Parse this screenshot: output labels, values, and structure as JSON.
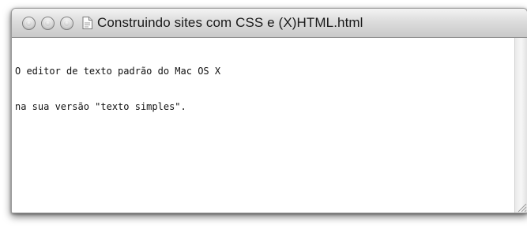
{
  "window": {
    "title": "Construindo sites com  CSS e (X)HTML.html",
    "controls": [
      "close",
      "minimize",
      "zoom"
    ],
    "document_icon": "document-icon"
  },
  "editor": {
    "lines": [
      "O editor de texto padrão do Mac OS X",
      "na sua versão \"texto simples\"."
    ]
  },
  "colors": {
    "titlebar_top": "#f4f4f4",
    "titlebar_bottom": "#c9c9c9",
    "text": "#111111",
    "background": "#ffffff"
  }
}
